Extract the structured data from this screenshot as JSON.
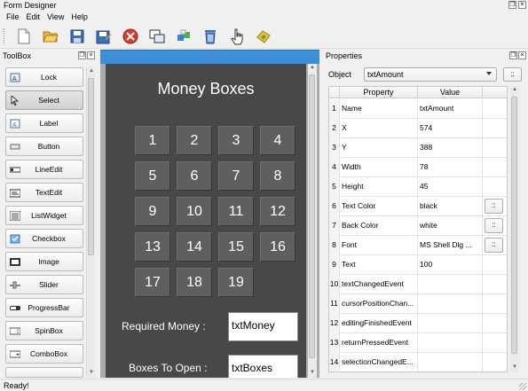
{
  "window": {
    "title": "Form Designer"
  },
  "menu": [
    "File",
    "Edit",
    "View",
    "Help"
  ],
  "toolbar_icons": [
    "new-file-icon",
    "open-folder-icon",
    "save-icon",
    "save-as-icon",
    "stop-icon",
    "copy-window-icon",
    "arrange-icon",
    "delete-icon",
    "hand-pointer-icon",
    "run-icon"
  ],
  "toolbox": {
    "title": "ToolBox",
    "items": [
      {
        "label": "Lock",
        "icon": "lock-icon",
        "selected": false
      },
      {
        "label": "Select",
        "icon": "pointer-icon",
        "selected": true
      },
      {
        "label": "Label",
        "icon": "label-icon",
        "selected": false
      },
      {
        "label": "Button",
        "icon": "button-icon",
        "selected": false
      },
      {
        "label": "LineEdit",
        "icon": "line-edit-icon",
        "selected": false
      },
      {
        "label": "TextEdit",
        "icon": "text-edit-icon",
        "selected": false
      },
      {
        "label": "ListWidget",
        "icon": "list-widget-icon",
        "selected": false
      },
      {
        "label": "Checkbox",
        "icon": "checkbox-icon",
        "selected": false
      },
      {
        "label": "Image",
        "icon": "image-icon",
        "selected": false
      },
      {
        "label": "Slider",
        "icon": "slider-icon",
        "selected": false
      },
      {
        "label": "ProgressBar",
        "icon": "progress-bar-icon",
        "selected": false
      },
      {
        "label": "SpinBox",
        "icon": "spin-box-icon",
        "selected": false
      },
      {
        "label": "ComboBox",
        "icon": "combo-box-icon",
        "selected": false
      },
      {
        "label": "",
        "icon": "more-icon",
        "selected": false
      }
    ]
  },
  "form": {
    "title": "Money Boxes",
    "buttons": [
      "1",
      "2",
      "3",
      "4",
      "5",
      "6",
      "7",
      "8",
      "9",
      "10",
      "11",
      "12",
      "13",
      "14",
      "15",
      "16",
      "17",
      "18",
      "19"
    ],
    "required_label": "Required Money :",
    "required_value": "txtMoney",
    "boxes_label": "Boxes To Open :",
    "boxes_value": "txtBoxes"
  },
  "properties": {
    "title": "Properties",
    "object_label": "Object",
    "object_value": "txtAmount",
    "more_label": "::",
    "col_property": "Property",
    "col_value": "Value",
    "rows": [
      {
        "n": "1",
        "name": "Name",
        "value": "txtAmount",
        "btn": ""
      },
      {
        "n": "2",
        "name": "X",
        "value": "574",
        "btn": ""
      },
      {
        "n": "3",
        "name": "Y",
        "value": "388",
        "btn": ""
      },
      {
        "n": "4",
        "name": "Width",
        "value": "78",
        "btn": ""
      },
      {
        "n": "5",
        "name": "Height",
        "value": "45",
        "btn": ""
      },
      {
        "n": "6",
        "name": "Text Color",
        "value": "black",
        "btn": "::"
      },
      {
        "n": "7",
        "name": "Back Color",
        "value": "white",
        "btn": "::"
      },
      {
        "n": "8",
        "name": "Font",
        "value": "MS Shell Dlg ...",
        "btn": "::"
      },
      {
        "n": "9",
        "name": "Text",
        "value": "100",
        "btn": ""
      },
      {
        "n": "10",
        "name": "textChangedEvent",
        "value": "",
        "btn": ""
      },
      {
        "n": "11",
        "name": "cursorPositionChan...",
        "value": "",
        "btn": ""
      },
      {
        "n": "12",
        "name": "editingFinishedEvent",
        "value": "",
        "btn": ""
      },
      {
        "n": "13",
        "name": "returnPressedEvent",
        "value": "",
        "btn": ""
      },
      {
        "n": "14",
        "name": "selectionChangedE...",
        "value": "",
        "btn": ""
      }
    ]
  },
  "status": {
    "text": "Ready!"
  },
  "colors": {
    "form_bg": "#484848",
    "button_bg": "#5f5f5f",
    "canvas_header": "#3d8fd8"
  }
}
